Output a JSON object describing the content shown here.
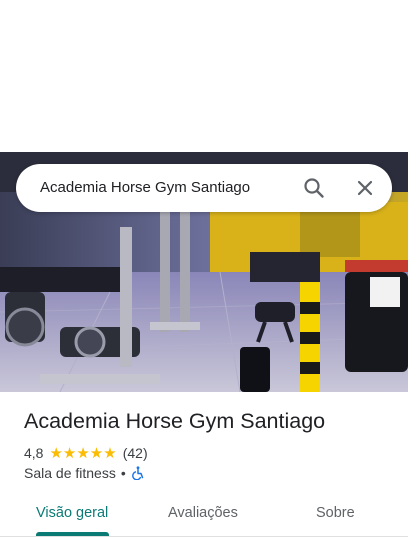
{
  "search": {
    "query": "Academia Horse Gym Santiago"
  },
  "place": {
    "name": "Academia Horse Gym Santiago",
    "rating": "4,8",
    "stars": "★★★★★",
    "review_count": "(42)",
    "category": "Sala de fitness",
    "separator": "•",
    "accessibility_icon": "wheelchair-icon"
  },
  "tabs": [
    {
      "label": "Visão geral",
      "active": true
    },
    {
      "label": "Avaliações",
      "active": false
    },
    {
      "label": "Sobre",
      "active": false
    }
  ],
  "colors": {
    "accent": "#0b7a75",
    "star": "#fbbc04",
    "wheelchair": "#1a73e8"
  },
  "hero": {
    "image": "gym interior photo"
  }
}
